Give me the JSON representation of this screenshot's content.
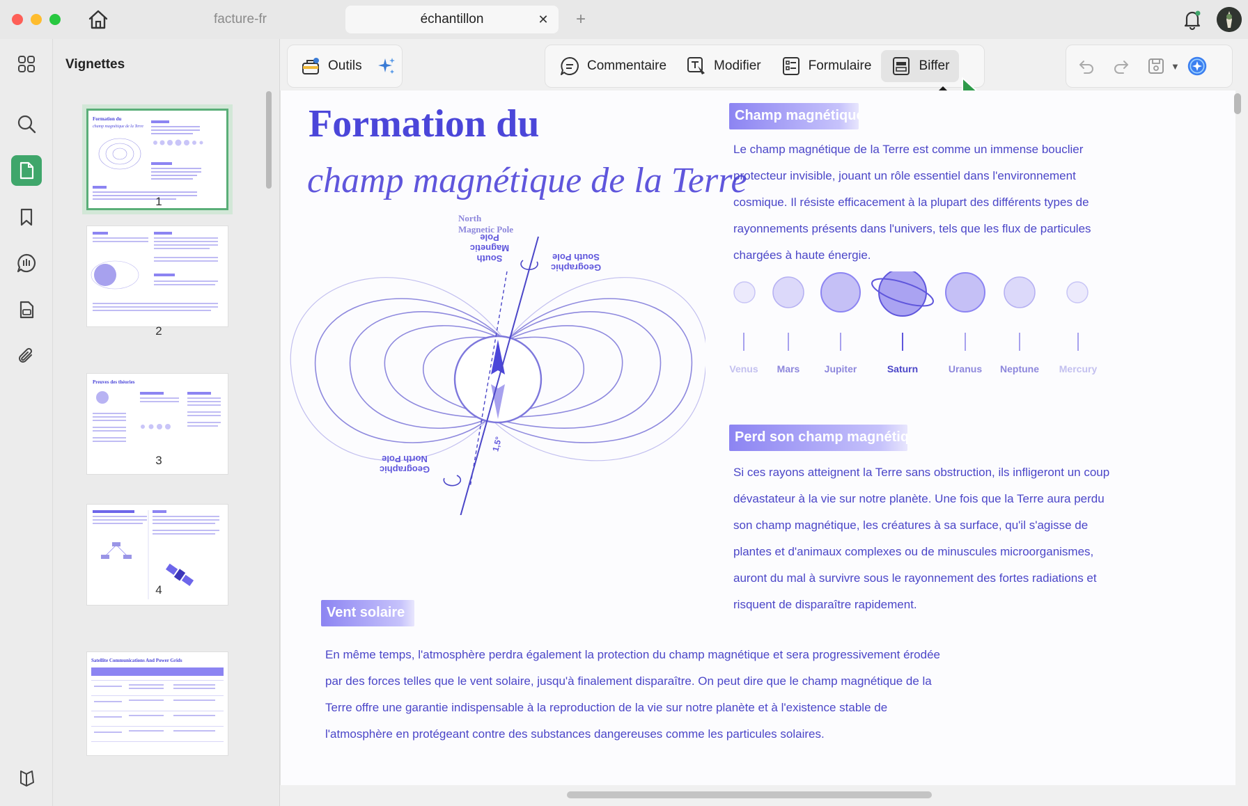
{
  "tabs": [
    {
      "label": "facture-fr",
      "active": false
    },
    {
      "label": "échantillon",
      "active": true
    }
  ],
  "panel": {
    "title": "Vignettes",
    "thumbnails": [
      "1",
      "2",
      "3",
      "4"
    ]
  },
  "toolbar": {
    "outils_label": "Outils",
    "commentaire_label": "Commentaire",
    "modifier_label": "Modifier",
    "formulaire_label": "Formulaire",
    "biffer_label": "Biffer",
    "tooltip_key": "4"
  },
  "document": {
    "title_line1": "Formation du",
    "title_line2": "champ magnétique de la Terre",
    "diagram_labels": {
      "north_magnetic_pole": "North Magnetic Pole",
      "south_magnetic_pole_flipped": "South Magnetic Pole",
      "geographic_south_pole": "Geographic South Pole",
      "geographic_north_pole": "Geographic North Pole",
      "angle": "1,5°"
    },
    "section1": {
      "heading": "Champ magnétique",
      "lines": [
        "Le champ magnétique de la Terre est comme un immense bouclier",
        "protecteur invisible, jouant un rôle essentiel dans l'environnement",
        "cosmique. Il résiste efficacement à la plupart des différents types de",
        "rayonnements présents dans l'univers, tels que les flux de particules",
        "chargées à haute énergie."
      ]
    },
    "planets": [
      "Venus",
      "Mars",
      "Jupiter",
      "Saturn",
      "Uranus",
      "Neptune",
      "Mercury"
    ],
    "section2": {
      "heading": "Perd son champ magnétique",
      "lines": [
        "Si ces rayons atteignent la Terre sans obstruction, ils infligeront un coup",
        "dévastateur à la vie sur notre planète. Une fois que la Terre aura perdu",
        "son champ magnétique, les créatures à sa surface, qu'il s'agisse de",
        "plantes et d'animaux complexes ou de minuscules microorganismes,",
        "auront du mal à survivre sous le rayonnement des fortes radiations et",
        "risquent de disparaître rapidement."
      ]
    },
    "section3": {
      "heading": "Vent solaire",
      "lines": [
        "En même temps, l'atmosphère perdra également la protection du champ magnétique et sera progressivement érodée",
        "par des forces telles que le vent solaire, jusqu'à finalement disparaître. On peut dire que le champ magnétique de la",
        "Terre offre une garantie indispensable à la reproduction de la vie sur notre planète et à l'existence stable de",
        "l'atmosphère en protégeant contre des substances dangereuses comme les particules solaires."
      ]
    }
  },
  "colors": {
    "accent_green": "#3fa66b",
    "doc_purple": "#4b46d9",
    "text_purple": "#4b46c8"
  },
  "icons": [
    "home-icon",
    "close-icon",
    "plus-icon",
    "bell-icon",
    "grid-icon",
    "search-icon",
    "page-icon",
    "bookmark-icon",
    "comment-icon",
    "document-icon",
    "paperclip-icon",
    "layers-icon",
    "toolbox-icon",
    "sparkle-icon",
    "undo-icon",
    "redo-icon",
    "save-icon",
    "chevron-down-icon",
    "ai-assistant-icon",
    "cursor-icon"
  ]
}
